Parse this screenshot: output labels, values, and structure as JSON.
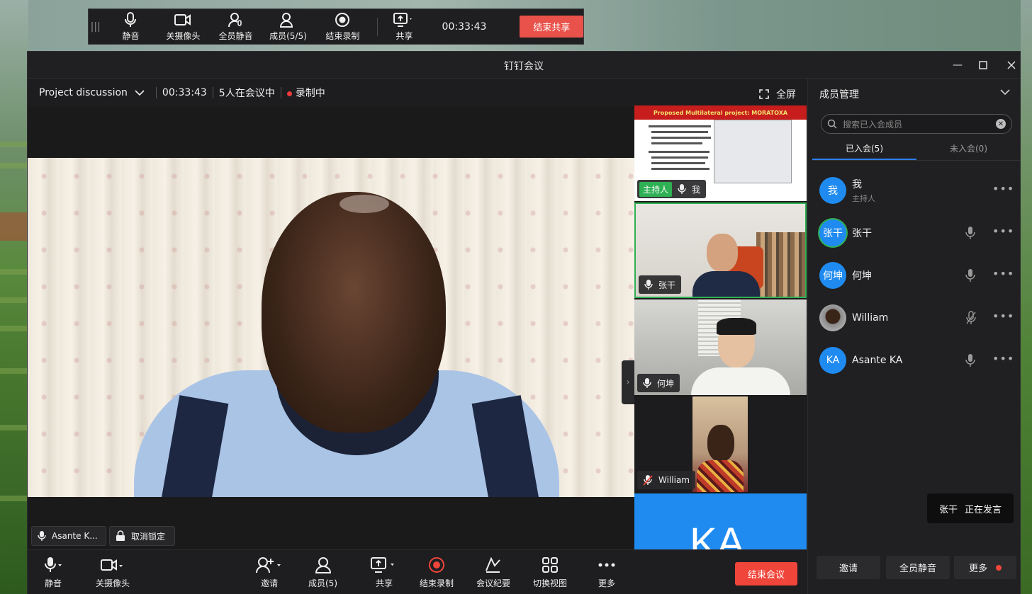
{
  "share_bar": {
    "mute": "静音",
    "camera_off": "关摄像头",
    "mute_all": "全员静音",
    "members": "成员(5/5)",
    "stop_recording": "结束录制",
    "share": "共享",
    "time": "00:33:43",
    "end_share": "结束共享"
  },
  "window": {
    "title": "钉钉会议"
  },
  "info_bar": {
    "meeting_title": "Project discussion",
    "time": "00:33:43",
    "participants": "5人在会议中",
    "recording": "录制中",
    "fullscreen": "全屏"
  },
  "main_video": {
    "name": "Asante K...",
    "unlock": "取消锁定"
  },
  "thumbnails": [
    {
      "host_tag": "主持人",
      "name": "我",
      "slide_title": "Proposed Multilateral project: MORATOXA"
    },
    {
      "name": "张干"
    },
    {
      "name": "何坤"
    },
    {
      "name": "William"
    },
    {
      "initials": "KA"
    }
  ],
  "bottom_bar": {
    "mute": "静音",
    "camera_off": "关摄像头",
    "invite": "邀请",
    "members": "成员(5)",
    "share": "共享",
    "stop_recording": "结束录制",
    "minutes": "会议纪要",
    "switch_view": "切换视图",
    "more": "更多",
    "end_meeting": "结束会议"
  },
  "panel": {
    "title": "成员管理",
    "search_placeholder": "搜索已入会成员",
    "tab_joined": "已入会(5)",
    "tab_not_joined": "未入会(0)",
    "members": [
      {
        "avatar": "我",
        "name": "我",
        "role": "主持人"
      },
      {
        "avatar": "张干",
        "name": "张干"
      },
      {
        "avatar": "何坤",
        "name": "何坤"
      },
      {
        "avatar": "",
        "name": "William"
      },
      {
        "avatar": "KA",
        "name": "Asante KA"
      }
    ],
    "speaking_name": "张干",
    "speaking_status": "正在发言",
    "invite": "邀请",
    "mute_all": "全员静音",
    "more": "更多"
  },
  "colors": {
    "accent_blue": "#1f8bf0",
    "end_red": "#f0453a",
    "host_green": "#2fb055",
    "recording_dot": "#ee3b3b"
  }
}
